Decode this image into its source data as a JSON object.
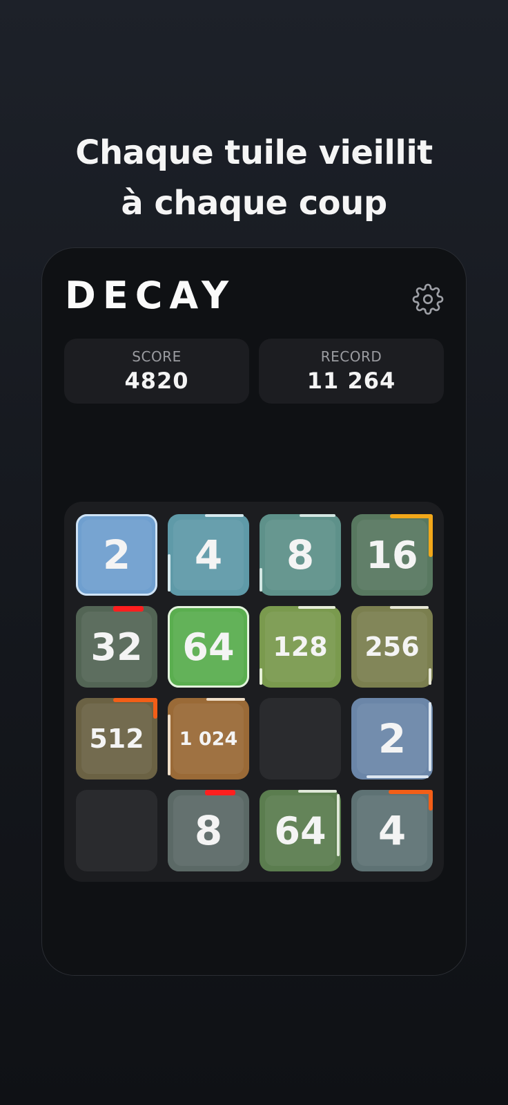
{
  "headline": {
    "line1": "Chaque tuile vieillit",
    "line2": "à chaque coup"
  },
  "app": {
    "title": "DECAY",
    "settings_icon": "gear-icon"
  },
  "stats": {
    "score_label": "SCORE",
    "score_value": "4820",
    "record_label": "RECORD",
    "record_value": "11 264"
  },
  "board": {
    "rows": [
      [
        {
          "value": "2",
          "color": "#6f9fcf",
          "outline": "#cfe3f5"
        },
        {
          "value": "4",
          "color": "#5f9aa8",
          "outline": "#d6e9ee"
        },
        {
          "value": "8",
          "color": "#5e918a",
          "outline": "#d3e6e2"
        },
        {
          "value": "16",
          "color": "#587860",
          "outline": "#f2a81a"
        }
      ],
      [
        {
          "value": "32",
          "color": "#536555",
          "outline": "#ff1f1f"
        },
        {
          "value": "64",
          "color": "#5aae4f",
          "outline": "#e3f3dd"
        },
        {
          "value": "128",
          "color": "#7a9a4e",
          "outline": "#e6eed8"
        },
        {
          "value": "256",
          "color": "#7b7f4f",
          "outline": "#e7e7d6"
        }
      ],
      [
        {
          "value": "512",
          "color": "#6b6244",
          "outline": "#f35e17"
        },
        {
          "value": "1 024",
          "color": "#9a6a37",
          "outline": "#f0dfc9"
        },
        {
          "value": "",
          "color": "#2a2b2e",
          "outline": ""
        },
        {
          "value": "2",
          "color": "#6b86a8",
          "outline": "#dbe5f0"
        }
      ],
      [
        {
          "value": "",
          "color": "#2a2b2e",
          "outline": ""
        },
        {
          "value": "8",
          "color": "#5b6966",
          "outline": "#ff1f1f"
        },
        {
          "value": "64",
          "color": "#5b7d4f",
          "outline": "#dfe8d8"
        },
        {
          "value": "4",
          "color": "#5e7274",
          "outline": "#f35e17"
        }
      ]
    ]
  }
}
